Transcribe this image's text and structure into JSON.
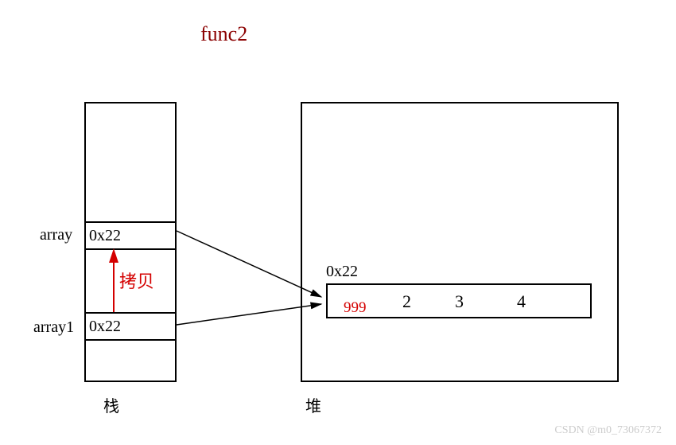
{
  "title": "func2",
  "stack": {
    "label1": "array",
    "cell1": "0x22",
    "label2": "array1",
    "cell2": "0x22",
    "copy_label": "拷贝",
    "caption": "栈"
  },
  "heap": {
    "address": "0x22",
    "new_value": "999",
    "values": [
      "2",
      "3",
      "4"
    ],
    "caption": "堆"
  },
  "watermark": "CSDN @m0_73067372"
}
